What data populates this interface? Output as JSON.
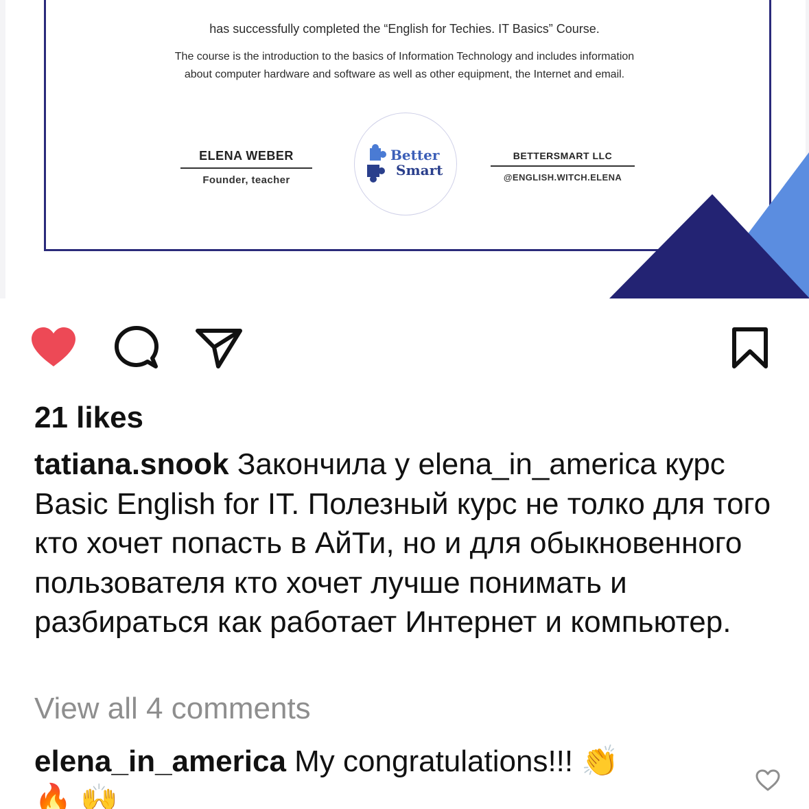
{
  "certificate": {
    "line1": "has successfully completed the “English for Techies. IT Basics” Course.",
    "line2": "The course is the introduction to the basics  of Information Technology and includes information",
    "line3": "about computer hardware and software as well as other equipment, the Internet and email.",
    "signer_left": {
      "name": "ELENA WEBER",
      "role": "Founder, teacher"
    },
    "signer_right": {
      "name": "BETTERSMART LLC",
      "role": "@ENGLISH.WITCH.ELENA"
    },
    "logo": {
      "line1": "Better",
      "line2": "Smart"
    },
    "colors": {
      "frame": "#2a2a7a",
      "triangle_dark": "#232373",
      "triangle_light": "#5b8de0",
      "logo_blue": "#3c5fb8"
    }
  },
  "actions": {
    "like_icon": "heart-filled-icon",
    "comment_icon": "comment-bubble-icon",
    "share_icon": "paper-plane-icon",
    "save_icon": "bookmark-icon",
    "like_color": "#ed4956"
  },
  "post": {
    "likes": "21 likes",
    "caption_user": "tatiana.snook",
    "caption_text": "Закончила у elena_in_america курс Basic English for IT. Полезный курс не толко для того кто хочет попасть в АйТи, но и для обыкновенного пользователя кто хочет лучше понимать и разбираться как работает Интернет и компьютер.",
    "view_all": "View all 4 comments"
  },
  "comment": {
    "user": "elena_in_america",
    "text": "My congratulations!!!",
    "emojis": [
      "👏",
      "🔥",
      "🙌"
    ]
  }
}
